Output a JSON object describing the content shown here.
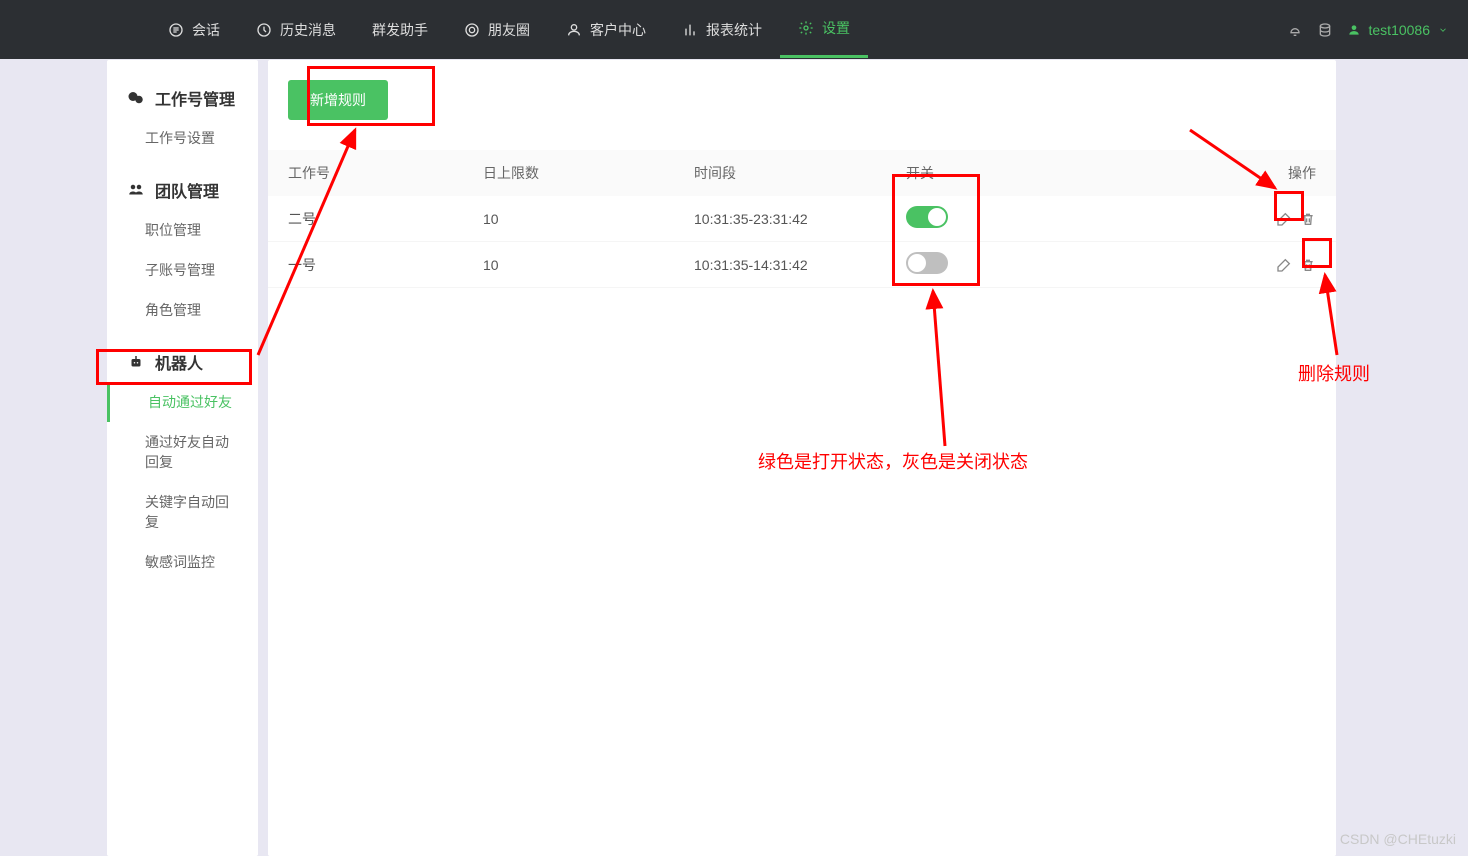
{
  "nav": {
    "items": [
      {
        "label": "会话"
      },
      {
        "label": "历史消息"
      },
      {
        "label": "群发助手"
      },
      {
        "label": "朋友圈"
      },
      {
        "label": "客户中心"
      },
      {
        "label": "报表统计"
      },
      {
        "label": "设置"
      }
    ],
    "username": "test10086"
  },
  "sidebar": {
    "sections": [
      {
        "title": "工作号管理",
        "items": [
          {
            "label": "工作号设置"
          }
        ]
      },
      {
        "title": "团队管理",
        "items": [
          {
            "label": "职位管理"
          },
          {
            "label": "子账号管理"
          },
          {
            "label": "角色管理"
          }
        ]
      },
      {
        "title": "机器人",
        "items": [
          {
            "label": "自动通过好友",
            "active": true
          },
          {
            "label": "通过好友自动回复"
          },
          {
            "label": "关键字自动回复"
          },
          {
            "label": "敏感词监控"
          }
        ]
      }
    ]
  },
  "main": {
    "add_button": "新增规则",
    "columns": {
      "c1": "工作号",
      "c2": "日上限数",
      "c3": "时间段",
      "c4": "开关",
      "c5": "操作"
    },
    "rows": [
      {
        "c1": "二号",
        "c2": "10",
        "c3": "10:31:35-23:31:42",
        "toggle": "on"
      },
      {
        "c1": "一号",
        "c2": "10",
        "c3": "10:31:35-14:31:42",
        "toggle": "off"
      }
    ]
  },
  "annotations": {
    "toggle_note": "绿色是打开状态，灰色是关闭状态",
    "delete_note": "删除规则"
  },
  "watermark": "CSDN @CHEtuzki"
}
